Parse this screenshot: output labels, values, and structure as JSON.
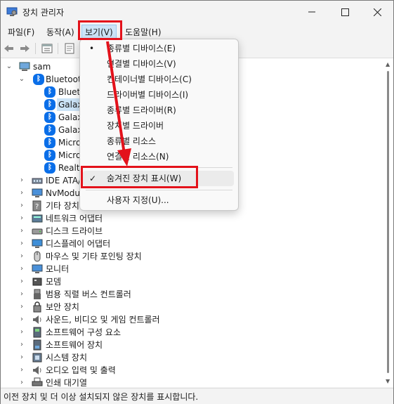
{
  "window": {
    "title": "장치 관리자",
    "controls": {
      "minimize_icon": "minimize-icon",
      "maximize_icon": "maximize-icon",
      "close_icon": "close-icon"
    }
  },
  "menubar": {
    "items": [
      {
        "label": "파일(F)"
      },
      {
        "label": "동작(A)"
      },
      {
        "label": "보기(V)"
      },
      {
        "label": "도움말(H)"
      }
    ]
  },
  "view_menu": {
    "items": [
      {
        "label": "종류별 디바이스(E)",
        "mark": "•"
      },
      {
        "label": "연결별 디바이스(V)",
        "mark": ""
      },
      {
        "label": "컨테이너별 디바이스(C)",
        "mark": ""
      },
      {
        "label": "드라이버별 디바이스(I)",
        "mark": ""
      },
      {
        "label": "종류별 드라이버(R)",
        "mark": ""
      },
      {
        "label": "장치별 드라이버",
        "mark": ""
      },
      {
        "label": "종류별 리소스",
        "mark": ""
      },
      {
        "label": "연결별 리소스(N)",
        "mark": ""
      }
    ],
    "hidden_devices": {
      "label": "숨겨진 장치 표시(W)",
      "mark": "✓"
    },
    "customize": {
      "label": "사용자 지정(U)..."
    }
  },
  "tree": {
    "root": "sam",
    "bluetooth": {
      "label": "Bluetooth",
      "children": [
        "Bluetoo",
        "Galax",
        "Galax",
        "Galax",
        "Micro",
        "Micro",
        "Realte"
      ]
    },
    "categories": [
      "IDE ATA/",
      "NvModu",
      "기타 장치",
      "네트워크 어댑터",
      "디스크 드라이브",
      "디스플레이 어댑터",
      "마우스 및 기타 포인팅 장치",
      "모니터",
      "모뎀",
      "범용 직렬 버스 컨트롤러",
      "보안 장치",
      "사운드, 비디오 및 게임 컨트롤러",
      "소프트웨어 구성 요소",
      "소프트웨어 장치",
      "시스템 장치",
      "오디오 입력 및 출력",
      "인쇄 대기열"
    ]
  },
  "statusbar": {
    "text": "이전 장치 및 더 이상 설치되지 않은 장치를 표시합니다."
  },
  "colors": {
    "annotation_red": "#e3121b",
    "menu_highlight": "#cce4f7",
    "bluetooth_blue": "#0a6ee8"
  }
}
